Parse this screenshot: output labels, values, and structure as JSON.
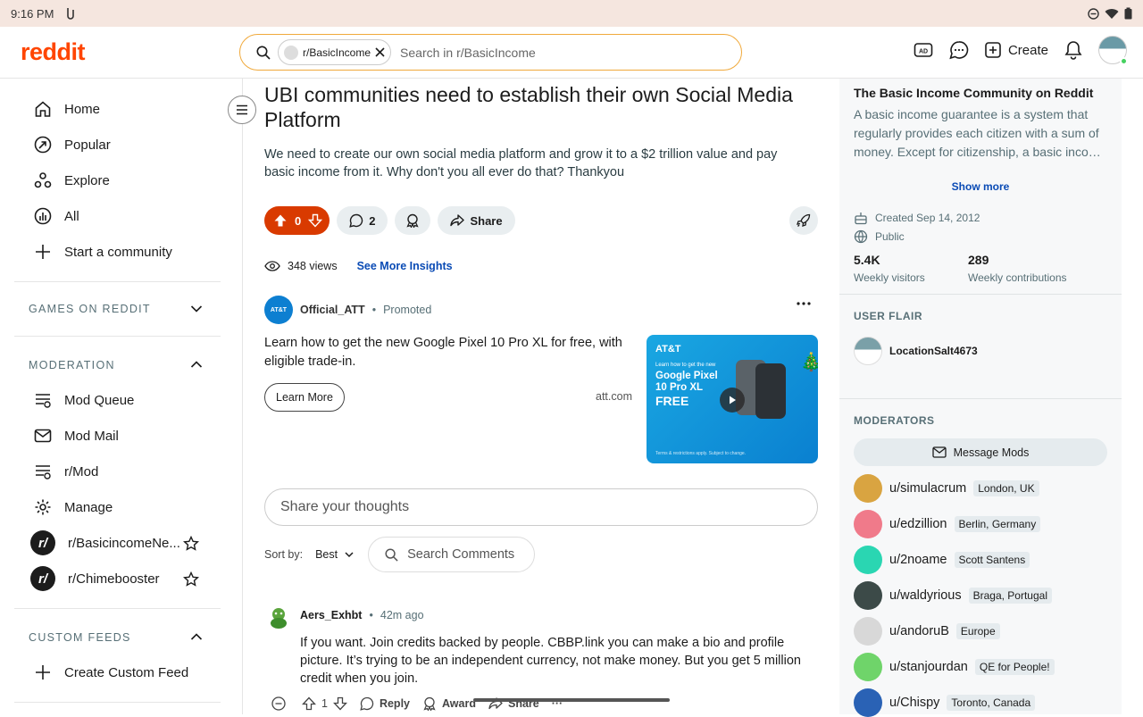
{
  "status_bar": {
    "time": "9:16 PM"
  },
  "header": {
    "logo": "reddit",
    "search": {
      "chip_label": "r/BasicIncome",
      "placeholder": "Search in r/BasicIncome"
    },
    "create_label": "Create"
  },
  "left_nav": {
    "items": [
      {
        "label": "Home"
      },
      {
        "label": "Popular"
      },
      {
        "label": "Explore"
      },
      {
        "label": "All"
      },
      {
        "label": "Start a community"
      }
    ],
    "games_heading": "GAMES ON REDDIT",
    "moderation_heading": "MODERATION",
    "moderation_items": [
      {
        "label": "Mod Queue"
      },
      {
        "label": "Mod Mail"
      },
      {
        "label": "r/Mod"
      },
      {
        "label": "Manage"
      },
      {
        "label": "r/BasicincomeNe..."
      },
      {
        "label": "r/Chimebooster"
      }
    ],
    "custom_feeds_heading": "CUSTOM FEEDS",
    "create_custom_feed": "Create Custom Feed"
  },
  "post": {
    "title": "UBI communities need to establish their own Social Media Platform",
    "body": "We need to create our own social media platform and grow it to a $2 trillion value and pay basic income from it. Why don't you all ever do that? Thankyou",
    "votes": "0",
    "comments": "2",
    "share_label": "Share",
    "views": "348 views",
    "insights_label": "See More Insights"
  },
  "ad": {
    "advertiser": "Official_ATT",
    "promoted": "Promoted",
    "text": "Learn how to get the new Google Pixel 10 Pro XL for free, with eligible trade-in.",
    "cta": "Learn More",
    "domain": "att.com",
    "image": {
      "brand": "AT&T",
      "line1": "Learn how to get the new",
      "line2": "Google Pixel 10 Pro XL",
      "free": "FREE",
      "fine": "Terms & restrictions apply. Subject to change."
    }
  },
  "comments_section": {
    "placeholder": "Share your thoughts",
    "sort_label": "Sort by:",
    "sort_value": "Best",
    "search_label": "Search Comments"
  },
  "comment": {
    "user": "Aers_Exhbt",
    "time": "42m ago",
    "body": "If you want. Join credits backed by people. CBBP.link you can make a bio and profile picture. It’s trying to be an independent currency, not make money. But you get 5 million credit when you join.",
    "votes": "1",
    "reply": "Reply",
    "award": "Award",
    "share": "Share",
    "more": "···"
  },
  "sidebar": {
    "title": "The Basic Income Community on Reddit",
    "description": "A basic income guarantee is a system that regularly provides each citizen with a sum of money. Except for citizenship, a basic inco…",
    "show_more": "Show more",
    "created": "Created Sep 14, 2012",
    "visibility": "Public",
    "weekly_visitors": "5.4K",
    "weekly_visitors_label": "Weekly visitors",
    "weekly_contributions": "289",
    "weekly_contributions_label": "Weekly contributions",
    "user_flair_heading": "USER FLAIR",
    "flair_user": "LocationSalt4673",
    "moderators_heading": "MODERATORS",
    "message_mods": "Message Mods",
    "moderators": [
      {
        "name": "u/simulacrum",
        "flair": "London, UK",
        "color": "#d9a441"
      },
      {
        "name": "u/edzillion",
        "flair": "Berlin, Germany",
        "color": "#f07a8a"
      },
      {
        "name": "u/2noame",
        "flair": "Scott Santens",
        "color": "#2ad6b2"
      },
      {
        "name": "u/waldyrious",
        "flair": "Braga, Portugal",
        "color": "#3c4a48"
      },
      {
        "name": "u/andoruB",
        "flair": "Europe",
        "color": "#d8d8d8"
      },
      {
        "name": "u/stanjourdan",
        "flair": "QE for People!",
        "color": "#6fd46a"
      },
      {
        "name": "u/Chispy",
        "flair": "Toronto, Canada",
        "color": "#2a62b5"
      }
    ]
  },
  "colors": {
    "brand": "#ff4500",
    "upvote_active": "#d93a00",
    "link": "#0a4bb5"
  }
}
